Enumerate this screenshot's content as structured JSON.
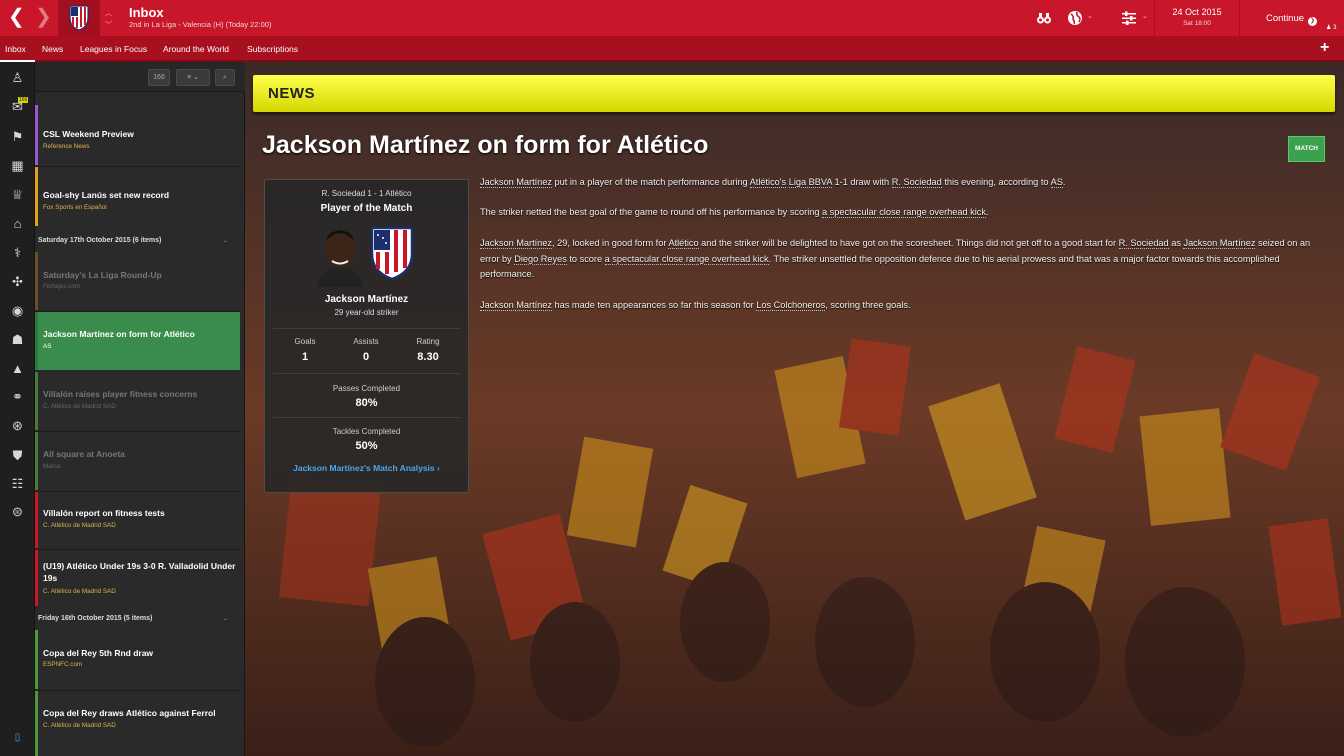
{
  "topbar": {
    "title": "Inbox",
    "subtitle": "2nd in La Liga - Valencia (H) (Today 22:00)",
    "date": "24 Oct 2015",
    "day_time": "Sat 18:00",
    "continue_label": "Continue",
    "mail_count": "3",
    "accent_color": "#c8172a"
  },
  "subnav": {
    "tabs": [
      "Inbox",
      "News",
      "Leagues in Focus",
      "Around the World",
      "Subscriptions"
    ],
    "plus": "+"
  },
  "sidebar": {
    "icons": [
      "manager-icon",
      "inbox-icon",
      "squad-icon",
      "schedule-icon",
      "competitions-icon",
      "club-icon",
      "staff-icon",
      "tactics-icon",
      "training-icon",
      "development-icon",
      "medical-icon",
      "scouting-icon",
      "transfers-icon",
      "club-info-icon",
      "team-icon",
      "finances-icon",
      "phone-icon"
    ],
    "inbox_badge": "166"
  },
  "list": {
    "count": "166",
    "items": [
      {
        "title": "CSL Weekend Preview",
        "source": "Reference News"
      },
      {
        "title": "Goal-shy Lanús set new record",
        "source": "Fox Sports en Español"
      },
      {
        "title": "Saturday's La Liga Round-Up",
        "source": "Fichajes.com"
      },
      {
        "title": "Jackson Martínez on form for Atlético",
        "source": "AS"
      },
      {
        "title": "Villalón raises player fitness concerns",
        "source": "C. Atlético de Madrid SAD"
      },
      {
        "title": "All square at Anoeta",
        "source": "Marca"
      },
      {
        "title": "Villalón report on fitness tests",
        "source": "C. Atlético de Madrid SAD"
      },
      {
        "title": "(U19) Atlético Under 19s 3-0 R. Valladolid Under 19s",
        "source": "C. Atlético de Madrid SAD"
      },
      {
        "title": "Copa del Rey 5th Rnd draw",
        "source": "ESPNFC.com"
      },
      {
        "title": "Copa del Rey draws Atlético against Ferrol",
        "source": "C. Atlético de Madrid SAD"
      }
    ],
    "groups": [
      "Saturday 17th October 2015 (6 items)",
      "Friday 16th October 2015 (5 items)"
    ]
  },
  "article": {
    "section": "NEWS",
    "headline": "Jackson Martínez on form for Atlético",
    "tag": "MATCH",
    "card": {
      "score": "R. Sociedad 1 - 1 Atlético",
      "award": "Player of the Match",
      "player": "Jackson Martínez",
      "desc": "29 year-old striker",
      "goals_label": "Goals",
      "goals": "1",
      "assists_label": "Assists",
      "assists": "0",
      "rating_label": "Rating",
      "rating": "8.30",
      "passes_label": "Passes Completed",
      "passes": "80%",
      "tackles_label": "Tackles Completed",
      "tackles": "50%",
      "analysis_link": "Jackson Martínez's Match Analysis"
    },
    "p1": {
      "a": "Jackson Martínez",
      "b": " put in a player of the match performance during ",
      "c": "Atlético's",
      "d": " ",
      "e": "Liga BBVA",
      "f": " 1-1 draw with ",
      "g": "R. Sociedad",
      "h": " this evening, according to ",
      "i": "AS",
      "j": "."
    },
    "p2": {
      "a": "The striker netted the best goal of the game to round off his performance by scoring ",
      "b": "a spectacular close range overhead kick",
      "c": "."
    },
    "p3": {
      "a": "Jackson Martínez",
      "b": ", 29, looked in good form for ",
      "c": "Atlético",
      "d": " and the striker will be delighted to have got on the scoresheet. Things did not get off to a good start for ",
      "e": "R. Sociedad",
      "f": " as ",
      "g": "Jackson Martínez",
      "h": " seized on an error by ",
      "i": "Diego Reyes",
      "j": " to score ",
      "k": "a spectacular close range overhead kick",
      "l": ". The striker unsettled the opposition defence due to his aerial prowess and that was a major factor towards this accomplished performance."
    },
    "p4": {
      "a": "Jackson Martínez",
      "b": " has made ten appearances so far this season for ",
      "c": "Los Colchoneros",
      "d": ", scoring three goals."
    }
  }
}
